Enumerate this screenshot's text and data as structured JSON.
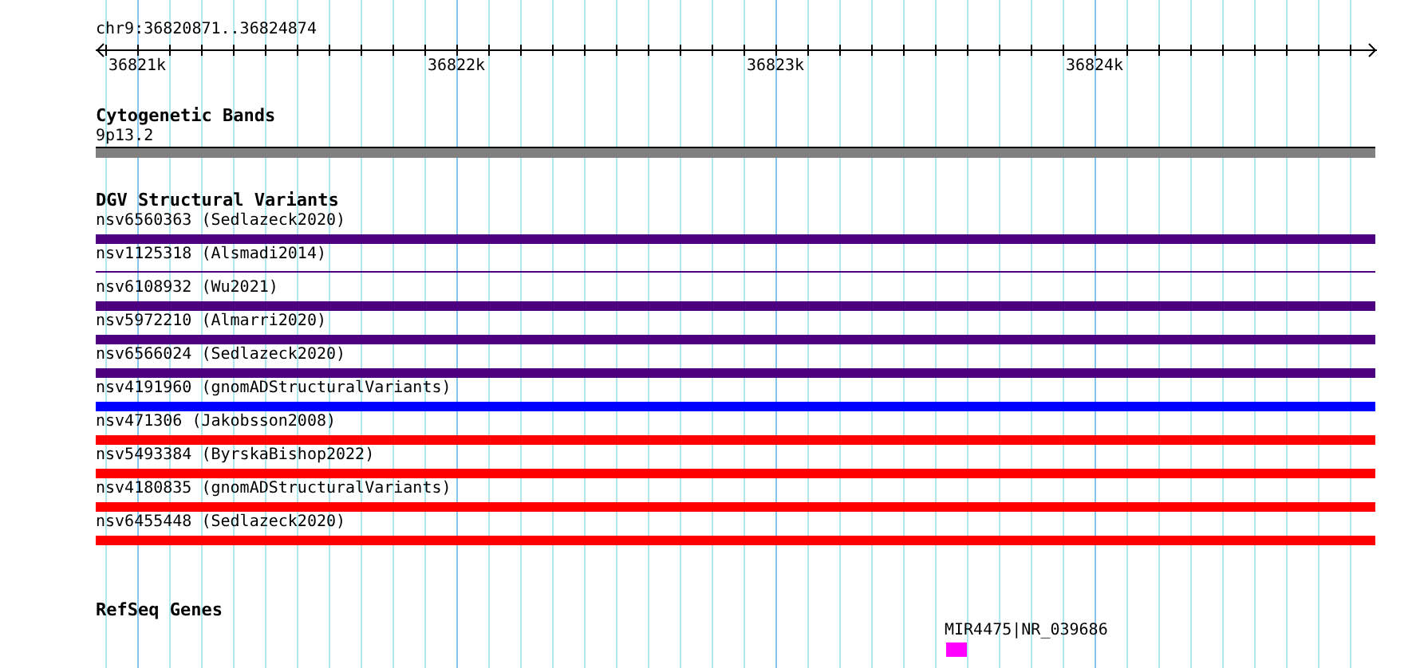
{
  "ruler": {
    "position": "chr9:36820871..36824874",
    "ticks": [
      "36821k",
      "36822k",
      "36823k",
      "36824k"
    ]
  },
  "tracks": [
    {
      "kind": "bands",
      "title": "Cytogenetic Bands",
      "items": [
        {
          "label": "9p13.2"
        }
      ]
    },
    {
      "kind": "variants",
      "title": "DGV Structural Variants",
      "items": [
        {
          "label": "nsv6560363 (Sedlazeck2020)",
          "color": "#4c0080",
          "thick": true
        },
        {
          "label": "nsv1125318 (Alsmadi2014)",
          "color": "#4c0080",
          "thick": false
        },
        {
          "label": "nsv6108932 (Wu2021)",
          "color": "#4c0080",
          "thick": true
        },
        {
          "label": "nsv5972210 (Almarri2020)",
          "color": "#4c0080",
          "thick": true
        },
        {
          "label": "nsv6566024 (Sedlazeck2020)",
          "color": "#4c0080",
          "thick": true
        },
        {
          "label": "nsv4191960 (gnomADStructuralVariants)",
          "color": "#0000ff",
          "thick": true
        },
        {
          "label": "nsv471306 (Jakobsson2008)",
          "color": "#ff0000",
          "thick": true
        },
        {
          "label": "nsv5493384 (ByrskaBishop2022)",
          "color": "#ff0000",
          "thick": true
        },
        {
          "label": "nsv4180835 (gnomADStructuralVariants)",
          "color": "#ff0000",
          "thick": true
        },
        {
          "label": "nsv6455448 (Sedlazeck2020)",
          "color": "#ff0000",
          "thick": true
        }
      ]
    },
    {
      "kind": "genes",
      "title": "RefSeq Genes",
      "items": [
        {
          "label": "MIR4475|NR_039686"
        }
      ]
    }
  ]
}
